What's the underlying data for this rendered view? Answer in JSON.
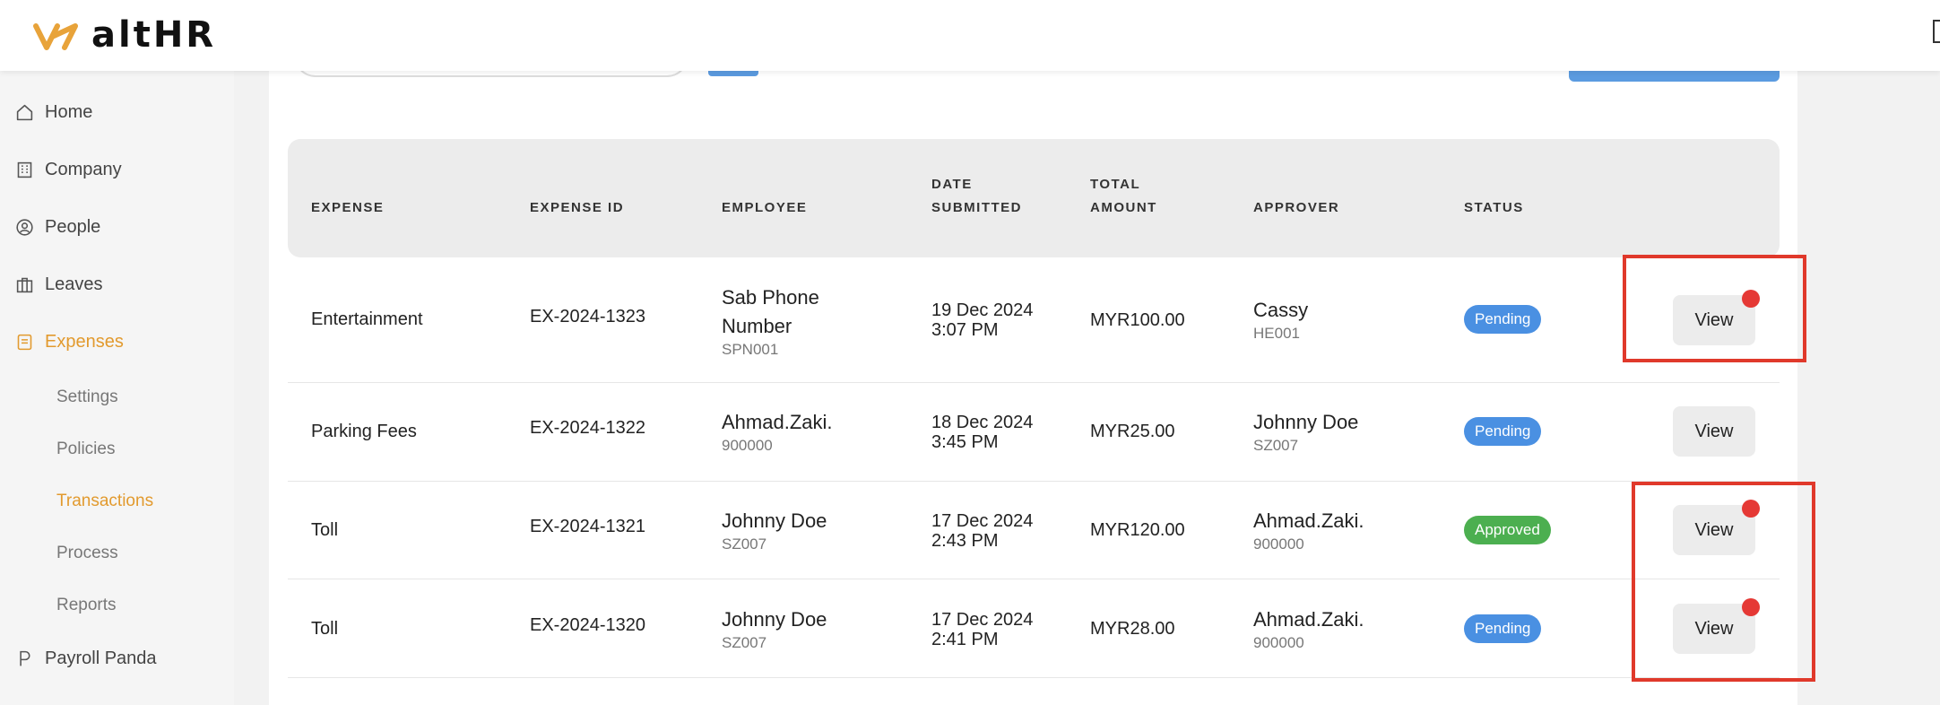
{
  "brand": {
    "name": "altHR",
    "accent_color": "#e29a2e"
  },
  "sidebar": {
    "items": [
      {
        "label": "Home",
        "icon": "home-icon"
      },
      {
        "label": "Company",
        "icon": "building-icon"
      },
      {
        "label": "People",
        "icon": "person-circle-icon"
      },
      {
        "label": "Leaves",
        "icon": "suitcase-icon"
      },
      {
        "label": "Expenses",
        "icon": "receipt-icon",
        "active": true
      },
      {
        "label": "Payroll Panda",
        "icon": "letter-p-icon"
      }
    ],
    "subitems": [
      {
        "label": "Settings"
      },
      {
        "label": "Policies"
      },
      {
        "label": "Transactions",
        "active": true
      },
      {
        "label": "Process"
      },
      {
        "label": "Reports"
      }
    ]
  },
  "table": {
    "headers": {
      "expense": "EXPENSE",
      "expense_id": "EXPENSE ID",
      "employee": "EMPLOYEE",
      "date_line1": "DATE",
      "date_line2": "SUBMITTED",
      "amount_line1": "TOTAL",
      "amount_line2": "AMOUNT",
      "approver": "APPROVER",
      "status": "STATUS"
    },
    "rows": [
      {
        "expense": "Entertainment",
        "expense_id": "EX-2024-1323",
        "employee_name": "Sab Phone Number",
        "employee_code": "SPN001",
        "date": "19 Dec 2024",
        "time": "3:07 PM",
        "amount": "MYR100.00",
        "approver_name": "Cassy",
        "approver_code": "HE001",
        "status": "Pending",
        "status_color": "#4a90e2",
        "action": "View"
      },
      {
        "expense": "Parking Fees",
        "expense_id": "EX-2024-1322",
        "employee_name": "Ahmad.Zaki.",
        "employee_code": "900000",
        "date": "18 Dec 2024",
        "time": "3:45 PM",
        "amount": "MYR25.00",
        "approver_name": "Johnny Doe",
        "approver_code": "SZ007",
        "status": "Pending",
        "status_color": "#4a90e2",
        "action": "View"
      },
      {
        "expense": "Toll",
        "expense_id": "EX-2024-1321",
        "employee_name": "Johnny Doe",
        "employee_code": "SZ007",
        "date": "17 Dec 2024",
        "time": "2:43 PM",
        "amount": "MYR120.00",
        "approver_name": "Ahmad.Zaki.",
        "approver_code": "900000",
        "status": "Approved",
        "status_color": "#4caf50",
        "action": "View"
      },
      {
        "expense": "Toll",
        "expense_id": "EX-2024-1320",
        "employee_name": "Johnny Doe",
        "employee_code": "SZ007",
        "date": "17 Dec 2024",
        "time": "2:41 PM",
        "amount": "MYR28.00",
        "approver_name": "Ahmad.Zaki.",
        "approver_code": "900000",
        "status": "Pending",
        "status_color": "#4a90e2",
        "action": "View"
      }
    ]
  },
  "annotations": {
    "highlight_color": "#e0392b",
    "dot_color": "#e53935"
  }
}
